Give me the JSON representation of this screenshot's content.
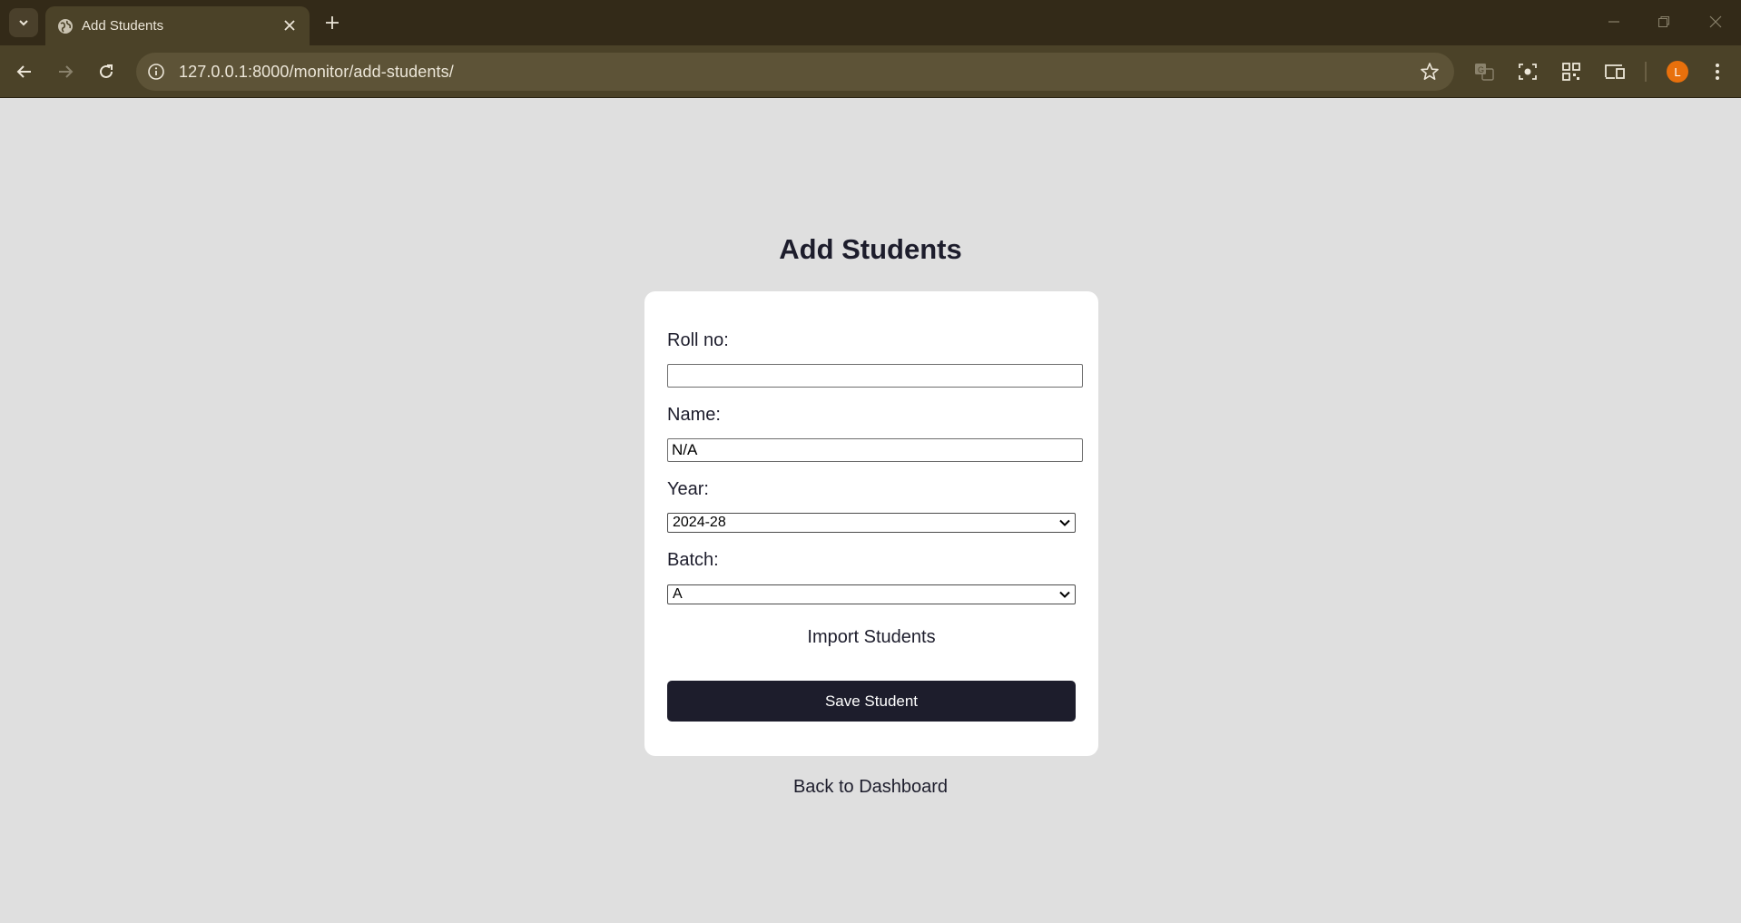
{
  "browser": {
    "tab_title": "Add Students",
    "url": "127.0.0.1:8000/monitor/add-students/",
    "profile_initial": "L",
    "icons": [
      "tab-list-icon",
      "globe-icon",
      "close-icon",
      "new-tab-icon",
      "minimize-icon",
      "restore-icon",
      "window-close-icon",
      "back-icon",
      "forward-icon",
      "reload-icon",
      "site-info-icon",
      "bookmark-star-icon",
      "translate-icon",
      "screenshot-icon",
      "qr-code-icon",
      "cast-icon",
      "menu-icon"
    ],
    "colors": {
      "tabbar": "#332a18",
      "toolbar": "#4b4228",
      "avatar": "#e8700c"
    }
  },
  "page": {
    "title": "Add Students",
    "form": {
      "roll_label": "Roll no:",
      "roll_value": "",
      "name_label": "Name:",
      "name_value": "N/A",
      "year_label": "Year:",
      "year_value": "2024-28",
      "batch_label": "Batch:",
      "batch_value": "A",
      "import_label": "Import Students",
      "save_label": "Save Student"
    },
    "back_label": "Back to Dashboard",
    "colors": {
      "background": "#dfdfdf",
      "button": "#1d1d2c",
      "text": "#1d1d2c"
    }
  }
}
